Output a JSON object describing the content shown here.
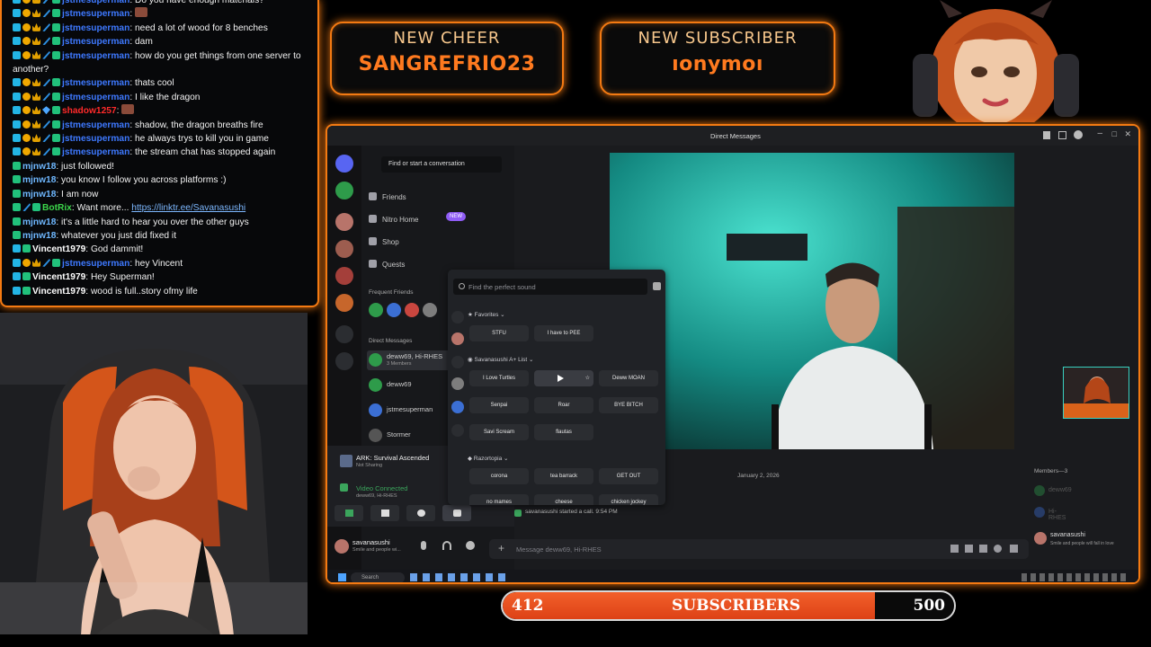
{
  "chat": {
    "messages": [
      {
        "user": "jstmesuperman",
        "color": "u-blue",
        "badges": [
          "sub",
          "bits",
          "vip",
          "bot",
          "mod"
        ],
        "text": "Do you have enough materials?"
      },
      {
        "user": "jstmesuperman",
        "color": "u-blue",
        "badges": [
          "sub",
          "bits",
          "vip",
          "bot",
          "mod"
        ],
        "text": "",
        "emote": true
      },
      {
        "user": "jstmesuperman",
        "color": "u-blue",
        "badges": [
          "sub",
          "bits",
          "vip",
          "bot",
          "mod"
        ],
        "text": "need a lot of wood for 8 benches"
      },
      {
        "user": "jstmesuperman",
        "color": "u-blue",
        "badges": [
          "sub",
          "bits",
          "vip",
          "bot",
          "mod"
        ],
        "text": "dam"
      },
      {
        "user": "jstmesuperman",
        "color": "u-blue",
        "badges": [
          "sub",
          "bits",
          "vip",
          "bot",
          "mod"
        ],
        "text": "how do you get things from one server to another?"
      },
      {
        "user": "jstmesuperman",
        "color": "u-blue",
        "badges": [
          "sub",
          "bits",
          "vip",
          "bot",
          "mod"
        ],
        "text": "thats cool"
      },
      {
        "user": "jstmesuperman",
        "color": "u-blue",
        "badges": [
          "sub",
          "bits",
          "vip",
          "bot",
          "mod"
        ],
        "text": "I like the dragon"
      },
      {
        "user": "shadow1257",
        "color": "u-red",
        "badges": [
          "sub",
          "bits",
          "vip",
          "gem",
          "mod"
        ],
        "text": "",
        "emote": true
      },
      {
        "user": "jstmesuperman",
        "color": "u-blue",
        "badges": [
          "sub",
          "bits",
          "vip",
          "bot",
          "mod"
        ],
        "text": "shadow, the dragon breaths fire"
      },
      {
        "user": "jstmesuperman",
        "color": "u-blue",
        "badges": [
          "sub",
          "bits",
          "vip",
          "bot",
          "mod"
        ],
        "text": "he always trys to kill you in game"
      },
      {
        "user": "jstmesuperman",
        "color": "u-blue",
        "badges": [
          "sub",
          "bits",
          "vip",
          "bot",
          "mod"
        ],
        "text": "the stream chat has stopped again"
      },
      {
        "user": "mjnw18",
        "color": "u-cyan",
        "badges": [
          "mod"
        ],
        "text": "just followed!"
      },
      {
        "user": "mjnw18",
        "color": "u-cyan",
        "badges": [
          "mod"
        ],
        "text": "you know I follow you across platforms :)"
      },
      {
        "user": "mjnw18",
        "color": "u-cyan",
        "badges": [
          "mod"
        ],
        "text": "I am now"
      },
      {
        "user": "BotRix",
        "color": "u-green",
        "badges": [
          "mod",
          "bot",
          "mod"
        ],
        "text": "Want more...",
        "link": "https://linktr.ee/Savanasushi"
      },
      {
        "user": "mjnw18",
        "color": "u-cyan",
        "badges": [
          "mod"
        ],
        "text": "it's a little hard to hear you over the other guys"
      },
      {
        "user": "mjnw18",
        "color": "u-cyan",
        "badges": [
          "mod"
        ],
        "text": "whatever you just did fixed it"
      },
      {
        "user": "Vincent1979",
        "color": "u-white",
        "badges": [
          "sub",
          "mod"
        ],
        "text": "God dammit!"
      },
      {
        "user": "jstmesuperman",
        "color": "u-blue",
        "badges": [
          "sub",
          "bits",
          "vip",
          "bot",
          "mod"
        ],
        "text": "hey Vincent"
      },
      {
        "user": "Vincent1979",
        "color": "u-white",
        "badges": [
          "sub",
          "mod"
        ],
        "text": "Hey Superman!"
      },
      {
        "user": "Vincent1979",
        "color": "u-white",
        "badges": [
          "sub",
          "mod"
        ],
        "text": "wood is full..story ofmy life"
      }
    ]
  },
  "alerts": {
    "cheer_title": "NEW CHEER",
    "cheer_name": "SANGREFRIO23",
    "sub_title": "NEW SUBSCRIBER",
    "sub_name": "ıonymoı"
  },
  "discord": {
    "window_title": "Direct Messages",
    "find_conversation": "Find or start a conversation",
    "nav": {
      "friends": "Friends",
      "nitro": "Nitro Home",
      "nitro_badge": "NEW",
      "shop": "Shop",
      "quests": "Quests"
    },
    "frequent_friends": "Frequent Friends",
    "direct_messages": "Direct Messages",
    "dms": [
      {
        "name": "deww69, Hi-RHES",
        "sub": "3 Members"
      },
      {
        "name": "deww69",
        "sub": ""
      },
      {
        "name": "jstmesuperman",
        "sub": ""
      },
      {
        "name": "Stormer",
        "sub": ""
      }
    ],
    "activity": {
      "game": "ARK: Survival Ascended",
      "status": "Not Sharing"
    },
    "voice": {
      "status": "Video Connected",
      "channel": "deww69, Hi-RHES"
    },
    "user": {
      "name": "savanasushi",
      "status": "Smile and people wi..."
    },
    "soundboard": {
      "search_placeholder": "Find the perfect sound",
      "favorites_label": "Favorites",
      "favorites": [
        "STFU",
        "I have to PEE"
      ],
      "list_label": "Savanasushi A+ List",
      "list": [
        "I Love Turtles",
        "",
        "Deww MOAN",
        "Senpai",
        "Roar",
        "BYE BITCH",
        "Savi Scream",
        "flautas"
      ],
      "razor_label": "Razortopia",
      "razor": [
        "corona",
        "tea barrack",
        "GET OUT",
        "no mames",
        "cheese",
        "chicken jockey"
      ]
    },
    "call": {
      "date": "January 2, 2026",
      "started": "savanasushi started a call. 9:54 PM",
      "members_label": "Members—3",
      "members": [
        "deww69",
        "Hi-RHES",
        "savanasushi"
      ],
      "member_status": "Smile and people will fall in love",
      "message_placeholder": "Message deww69, Hi-RHES"
    },
    "taskbar_search": "Search"
  },
  "subgoal": {
    "current": "412",
    "label": "SUBSCRIBERS",
    "target": "500",
    "progress": 0.824
  },
  "colors": {
    "accent": "#f47a12",
    "blurple": "#5865f2",
    "subbar_fill": "#ea5220"
  }
}
